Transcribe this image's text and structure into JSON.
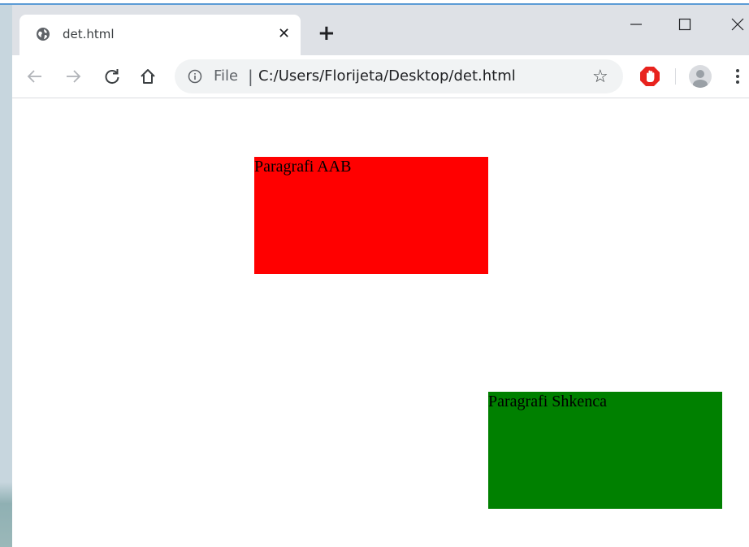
{
  "tab": {
    "title": "det.html",
    "close_glyph": "✕"
  },
  "new_tab_glyph": "+",
  "toolbar": {
    "scheme_label": "File",
    "separator": "|",
    "url": "C:/Users/Florijeta/Desktop/det.html",
    "star_glyph": "☆"
  },
  "colors": {
    "tabstrip": "#dee1e6",
    "box_red": "#ff0000",
    "box_green": "#008000",
    "extension_red": "#e8231e"
  },
  "page": {
    "paragraph_1": "Paragrafi AAB",
    "paragraph_2": "Paragrafi Shkenca"
  },
  "icons": [
    "globe-icon",
    "close-icon",
    "plus-icon",
    "minimize-icon",
    "maximize-icon",
    "window-close-icon",
    "back-arrow-icon",
    "forward-arrow-icon",
    "reload-icon",
    "home-icon",
    "info-icon",
    "star-icon",
    "stop-hand-icon",
    "avatar-icon",
    "menu-dots-icon"
  ]
}
